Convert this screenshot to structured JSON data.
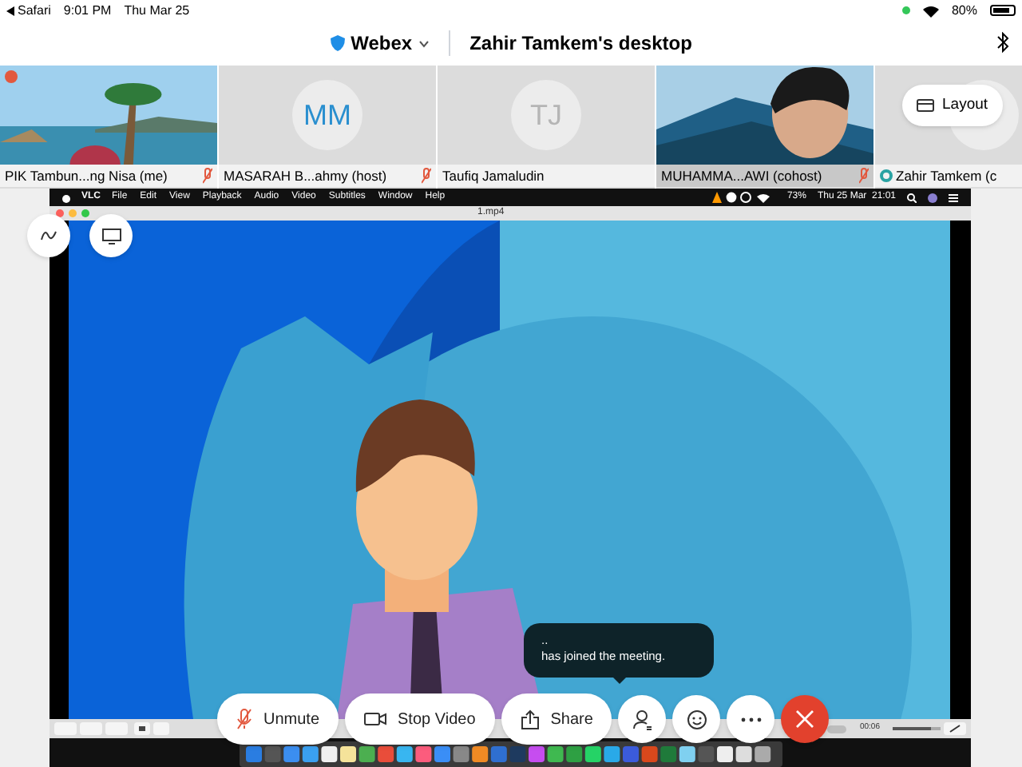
{
  "status_bar": {
    "back": "Safari",
    "time": "9:01 PM",
    "date": "Thu Mar 25",
    "battery": "80%"
  },
  "header": {
    "app": "Webex",
    "title": "Zahir Tamkem's desktop"
  },
  "participants": [
    {
      "name": "PIK Tambun...ng Nisa (me)",
      "muted": true,
      "speaking": false
    },
    {
      "name": "MASARAH B...ahmy (host)",
      "kind": "avatar",
      "initials": "MM",
      "muted": true,
      "speaking": false
    },
    {
      "name": "Taufiq Jamaludin",
      "kind": "avatar",
      "initials": "TJ",
      "muted": false,
      "speaking": false
    },
    {
      "name": "MUHAMMA...AWI (cohost)",
      "muted": true,
      "speaking": true
    },
    {
      "name": "Zahir Tamkem (c",
      "kind": "avatar",
      "muted": false,
      "speaking": false,
      "presenter": true
    }
  ],
  "layout_button": "Layout",
  "shared_screen": {
    "menu_bar": {
      "app": "VLC",
      "menus": [
        "File",
        "Edit",
        "View",
        "Playback",
        "Audio",
        "Video",
        "Subtitles",
        "Window",
        "Help"
      ],
      "battery": "73%",
      "clock": "Thu 25 Mar  21:01"
    },
    "window_title": "1.mp4",
    "player": {
      "time": "00:06",
      "volume": {
        "level": 0.8
      }
    }
  },
  "toast": {
    "lines": [
      "..",
      "has joined the meeting."
    ]
  },
  "toolbar": [
    {
      "kind": "mute",
      "label": "Unmute"
    },
    {
      "kind": "video",
      "label": "Stop Video"
    },
    {
      "kind": "share",
      "label": "Share"
    },
    {
      "kind": "participants"
    },
    {
      "kind": "reactions"
    },
    {
      "kind": "more"
    },
    {
      "kind": "end"
    }
  ]
}
